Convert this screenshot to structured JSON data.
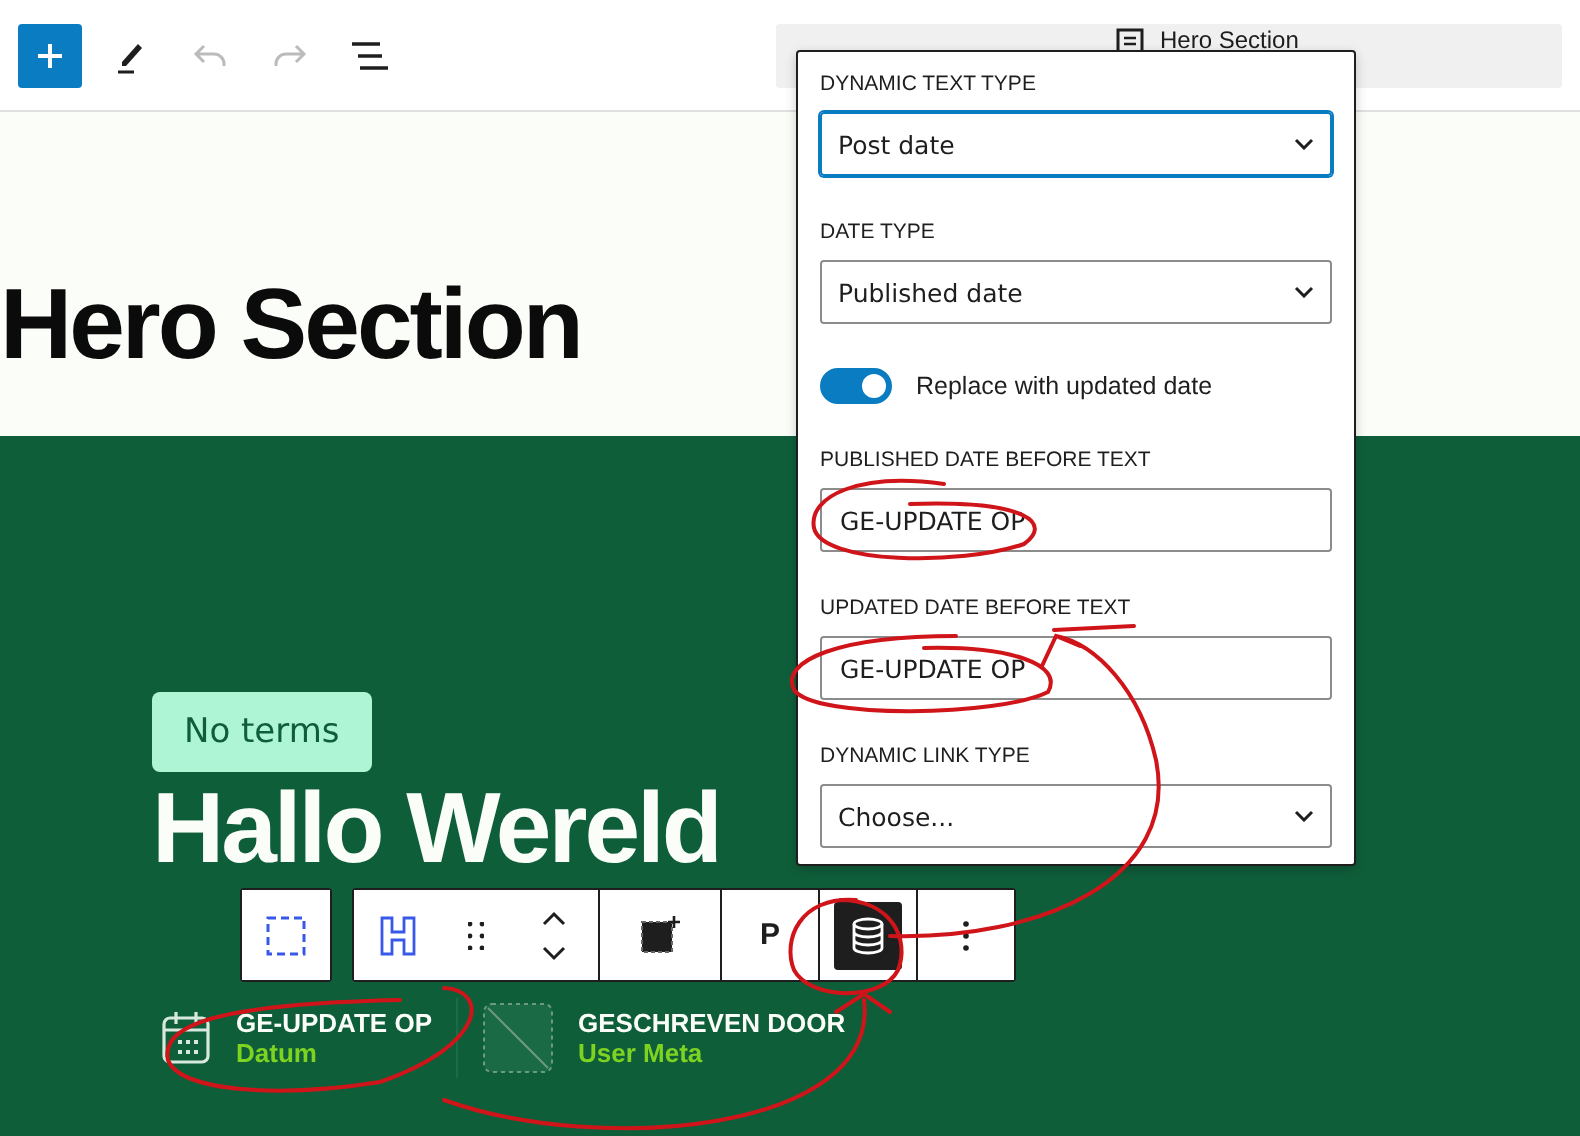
{
  "top_toolbar": [
    {
      "kind": "add",
      "disabled": false
    },
    {
      "kind": "edit",
      "disabled": false
    },
    {
      "kind": "undo",
      "disabled": true
    },
    {
      "kind": "redo",
      "disabled": true
    },
    {
      "kind": "outline",
      "disabled": false
    }
  ],
  "document_title": "Hero Section",
  "page_heading": "Hero Section",
  "hero": {
    "badge": "No terms",
    "heading": "Hallo Wereld"
  },
  "block_toolbar": [
    [
      {
        "kind": "parent",
        "selected": false
      }
    ],
    [
      {
        "kind": "heading",
        "selected": false
      },
      {
        "kind": "drag",
        "selected": false
      },
      {
        "kind": "move",
        "selected": false
      }
    ],
    [
      {
        "kind": "placeholder",
        "selected": false
      }
    ],
    [
      {
        "kind": "text",
        "label": "P",
        "selected": false
      }
    ],
    [
      {
        "kind": "dynamic",
        "selected": true
      }
    ],
    [
      {
        "kind": "more",
        "selected": false
      }
    ]
  ],
  "meta": [
    {
      "kind": "date",
      "title": "GE-UPDATE OP",
      "subtitle": "Datum"
    },
    {
      "kind": "placeholder",
      "title": "GESCHREVEN DOOR",
      "subtitle": "User Meta"
    }
  ],
  "popover": {
    "fields": [
      {
        "kind": "select",
        "label": "DYNAMIC TEXT TYPE",
        "value": "Post date",
        "focused": true
      },
      {
        "kind": "select",
        "label": "DATE TYPE",
        "value": "Published date",
        "focused": false
      },
      {
        "kind": "toggle",
        "label": "Replace with updated date",
        "on": true
      },
      {
        "kind": "text",
        "label": "PUBLISHED DATE BEFORE TEXT",
        "value": "GE-UPDATE OP"
      },
      {
        "kind": "text",
        "label": "UPDATED DATE BEFORE TEXT",
        "value": "GE-UPDATE OP"
      },
      {
        "kind": "select",
        "label": "DYNAMIC LINK TYPE",
        "value": "Choose...",
        "focused": false
      }
    ]
  }
}
